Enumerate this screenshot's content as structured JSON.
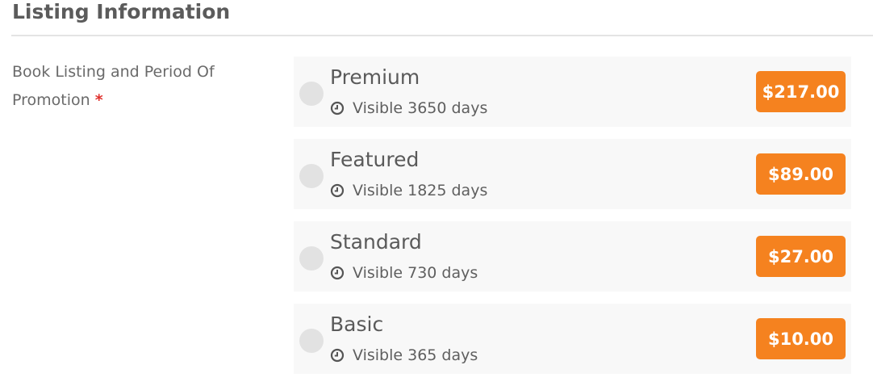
{
  "section": {
    "title": "Listing Information"
  },
  "field": {
    "label_line1": "Book Listing and Period Of",
    "label_line2": "Promotion",
    "required_mark": "*"
  },
  "colors": {
    "accent": "#f5821f",
    "required": "#e0312d"
  },
  "options": [
    {
      "name": "Premium",
      "visibility": "Visible 3650 days",
      "price": "$217.00",
      "selected": false,
      "icon": "clock-icon"
    },
    {
      "name": "Featured",
      "visibility": "Visible 1825 days",
      "price": "$89.00",
      "selected": false,
      "icon": "clock-icon"
    },
    {
      "name": "Standard",
      "visibility": "Visible 730 days",
      "price": "$27.00",
      "selected": false,
      "icon": "clock-icon"
    },
    {
      "name": "Basic",
      "visibility": "Visible 365 days",
      "price": "$10.00",
      "selected": false,
      "icon": "clock-icon"
    }
  ]
}
